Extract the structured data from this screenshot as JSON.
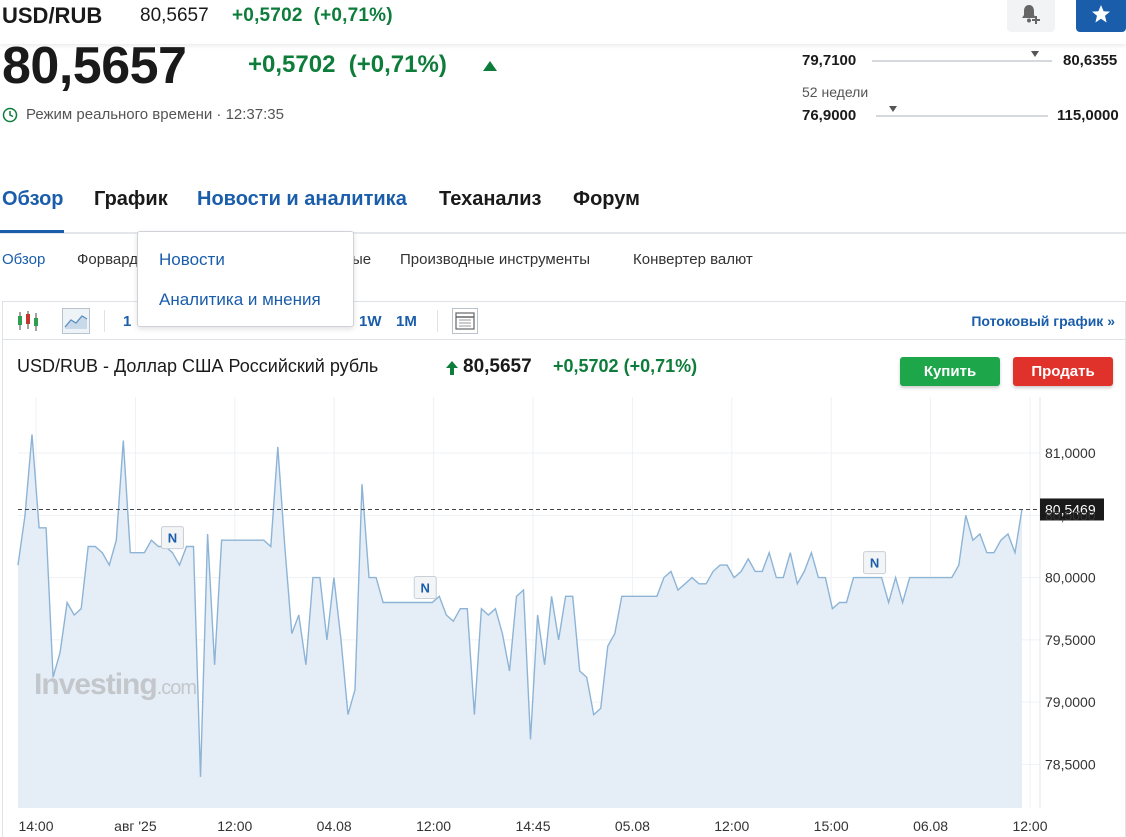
{
  "header": {
    "pair": "USD/RUB",
    "price": "80,5657",
    "change": "+0,5702",
    "change_pct": "(+0,71%)"
  },
  "quote": {
    "price": "80,5657",
    "change": "+0,5702",
    "change_pct": "(+0,71%)",
    "realtime_label": "Режим реального времени · 12:37:35"
  },
  "ranges": {
    "day_low": "79,7100",
    "day_high": "80,6355",
    "day_position": 0.903,
    "weeks_label": "52 недели",
    "week_low": "76,9000",
    "week_high": "115,0000",
    "week_position": 0.097
  },
  "tabs": [
    {
      "label": "Обзор"
    },
    {
      "label": "График"
    },
    {
      "label": "Новости и аналитика"
    },
    {
      "label": "Теханализ"
    },
    {
      "label": "Форум"
    }
  ],
  "subnav": [
    {
      "label": "Обзор"
    },
    {
      "label": "Форвард"
    },
    {
      "label": "ые"
    },
    {
      "label": "Производные инструменты"
    },
    {
      "label": "Конвертер валют"
    }
  ],
  "dropdown": {
    "items": [
      "Новости",
      "Аналитика и мнения"
    ]
  },
  "toolbar": {
    "range_1": "1",
    "range_1w": "1W",
    "range_1m": "1M",
    "stream_label": "Потоковый график »"
  },
  "chart_header": {
    "title": "USD/RUB - Доллар США Российский рубль",
    "price": "80,5657",
    "change": "+0,5702",
    "change_pct": "(+0,71%)",
    "buy_label": "Купить",
    "sell_label": "Продать"
  },
  "watermark": {
    "main": "Investing",
    "suffix": ".com"
  },
  "colors": {
    "accent": "#1a5dab",
    "positive": "#0e7c3a",
    "buy": "#1ea64a",
    "sell": "#e0322b",
    "line": "#8db4d6",
    "fill": "#e5eef6"
  },
  "chart_data": {
    "type": "area",
    "x_tick_labels": [
      "14:00",
      "авг '25",
      "12:00",
      "04.08",
      "12:00",
      "14:45",
      "05.08",
      "12:00",
      "15:00",
      "06.08",
      "12:00"
    ],
    "y_tick_labels": [
      "81,0000",
      "80,5000",
      "80,0000",
      "79,5000",
      "79,0000",
      "78,5000"
    ],
    "ylim": [
      78.15,
      81.45
    ],
    "reference_value": 80.5469,
    "reference_label": "80,5469",
    "news_marker_label": "N",
    "news_marker_points": [
      22,
      58,
      122
    ],
    "series": [
      {
        "values": [
          80.1,
          80.5,
          81.15,
          80.4,
          80.4,
          79.2,
          79.4,
          79.8,
          79.7,
          79.75,
          80.25,
          80.25,
          80.2,
          80.1,
          80.3,
          81.1,
          80.2,
          80.2,
          80.2,
          80.3,
          80.25,
          80.25,
          80.2,
          80.1,
          80.25,
          80.25,
          78.4,
          80.35,
          79.3,
          80.3,
          80.3,
          80.3,
          80.3,
          80.3,
          80.3,
          80.3,
          80.25,
          81.05,
          80.25,
          79.55,
          79.7,
          79.3,
          80.0,
          80.0,
          79.5,
          80.0,
          79.5,
          78.9,
          79.1,
          80.75,
          80.0,
          80.0,
          79.8,
          79.8,
          79.8,
          79.8,
          79.8,
          79.8,
          79.8,
          79.8,
          79.85,
          79.7,
          79.65,
          79.75,
          79.75,
          78.9,
          79.75,
          79.7,
          79.75,
          79.55,
          79.25,
          79.85,
          79.9,
          78.7,
          79.7,
          79.3,
          79.85,
          79.5,
          79.85,
          79.85,
          79.25,
          79.2,
          78.9,
          78.95,
          79.45,
          79.55,
          79.85,
          79.85,
          79.85,
          79.85,
          79.85,
          79.85,
          80.0,
          80.05,
          79.9,
          79.95,
          80.0,
          79.95,
          79.95,
          80.05,
          80.1,
          80.1,
          80.0,
          80.05,
          80.15,
          80.05,
          80.05,
          80.2,
          80.0,
          80.0,
          80.2,
          79.95,
          80.05,
          80.2,
          80.0,
          80.0,
          79.75,
          79.8,
          79.8,
          80.0,
          80.0,
          80.0,
          80.0,
          80.0,
          79.8,
          80.0,
          79.8,
          80.0,
          80.0,
          80.0,
          80.0,
          80.0,
          80.0,
          80.0,
          80.1,
          80.5,
          80.3,
          80.35,
          80.2,
          80.2,
          80.3,
          80.35,
          80.2,
          80.55
        ]
      }
    ]
  }
}
